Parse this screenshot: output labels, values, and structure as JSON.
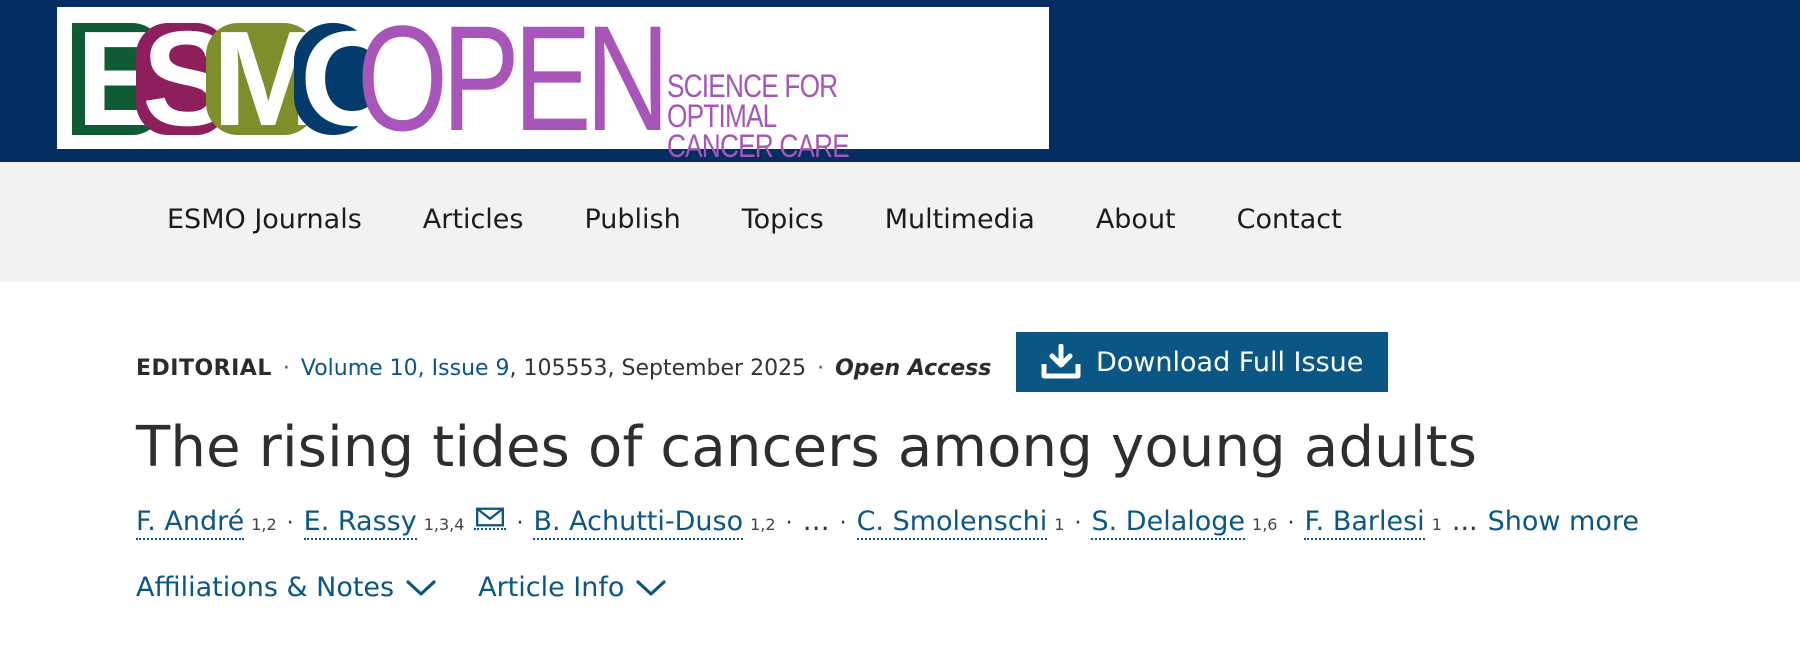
{
  "logo": {
    "esmo_letters": [
      "E",
      "S",
      "M",
      "O"
    ],
    "open": "OPEN",
    "tagline_1": "SCIENCE FOR OPTIMAL",
    "tagline_2": "CANCER CARE",
    "colors": {
      "e": "#0f5b33",
      "s": "#8c1f5c",
      "m": "#7d8e2a",
      "o": "#033c6c",
      "open": "#a755b8"
    }
  },
  "header": {
    "background": "#042d62"
  },
  "nav": {
    "items": [
      "ESMO Journals",
      "Articles",
      "Publish",
      "Topics",
      "Multimedia",
      "About",
      "Contact"
    ]
  },
  "meta": {
    "type": "EDITORIAL",
    "sep": "·",
    "issue_link": "Volume 10, Issue 9",
    "issue_rest": ", 105553, September 2025",
    "open_access": "Open Access"
  },
  "download": {
    "label": "Download Full Issue",
    "icon": "download-icon"
  },
  "article": {
    "title": "The rising tides of cancers among young adults"
  },
  "authors": {
    "list": [
      {
        "name": "F. André",
        "aff": "1,2"
      },
      {
        "name": "E. Rassy",
        "aff": "1,3,4"
      },
      {
        "name": "B. Achutti-Duso",
        "aff": "1,2"
      },
      {
        "name": "C. Smolenschi",
        "aff": "1"
      },
      {
        "name": "S. Delaloge",
        "aff": "1,6"
      },
      {
        "name": "F. Barlesi",
        "aff": "1"
      }
    ],
    "ellipsis": "…",
    "trailing": "...",
    "show_more": "Show more"
  },
  "toggles": {
    "affiliations": "Affiliations & Notes",
    "article_info": "Article Info"
  },
  "accent": "#0a5684"
}
